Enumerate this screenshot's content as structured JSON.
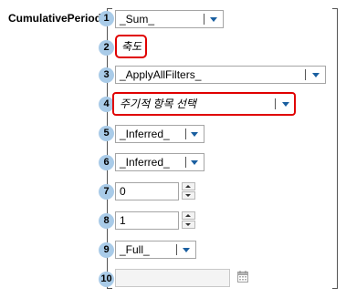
{
  "function_name": "CumulativePeriod",
  "params": [
    {
      "index": "1",
      "type": "dropdown",
      "value": "_Sum_"
    },
    {
      "index": "2",
      "type": "text",
      "value": "축도",
      "highlighted": true
    },
    {
      "index": "3",
      "type": "dropdown",
      "value": "_ApplyAllFilters_"
    },
    {
      "index": "4",
      "type": "dropdown",
      "value": "주기적 항목 선택",
      "highlighted": true
    },
    {
      "index": "5",
      "type": "dropdown",
      "value": "_Inferred_"
    },
    {
      "index": "6",
      "type": "dropdown",
      "value": "_Inferred_"
    },
    {
      "index": "7",
      "type": "spinner",
      "value": "0"
    },
    {
      "index": "8",
      "type": "spinner",
      "value": "1"
    },
    {
      "index": "9",
      "type": "dropdown",
      "value": "_Full_"
    },
    {
      "index": "10",
      "type": "date",
      "value": "",
      "disabled": true
    }
  ],
  "colors": {
    "badge": "#a9cbe8",
    "highlight": "#e00000",
    "arrow": "#1a5fa0"
  },
  "icons": {
    "dropdown": "chevron-down-icon",
    "spinner": "spin-up-down-icon",
    "date": "calendar-icon"
  }
}
